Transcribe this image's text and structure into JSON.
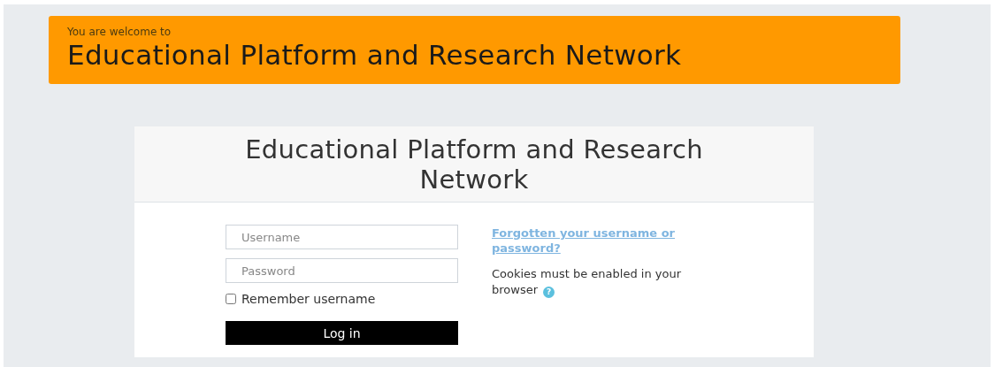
{
  "banner": {
    "subtitle": "You are welcome to",
    "title": "Educational Platform and Research Network"
  },
  "login": {
    "heading": "Educational Platform and Research Network",
    "username": {
      "placeholder": "Username"
    },
    "password": {
      "placeholder": "Password"
    },
    "remember": {
      "label": "Remember username",
      "checked": false
    },
    "submit": "Log in",
    "forgot_link": "Forgotten your username or password?",
    "cookies_note": "Cookies must be enabled in your browser",
    "help_icon": "?"
  }
}
